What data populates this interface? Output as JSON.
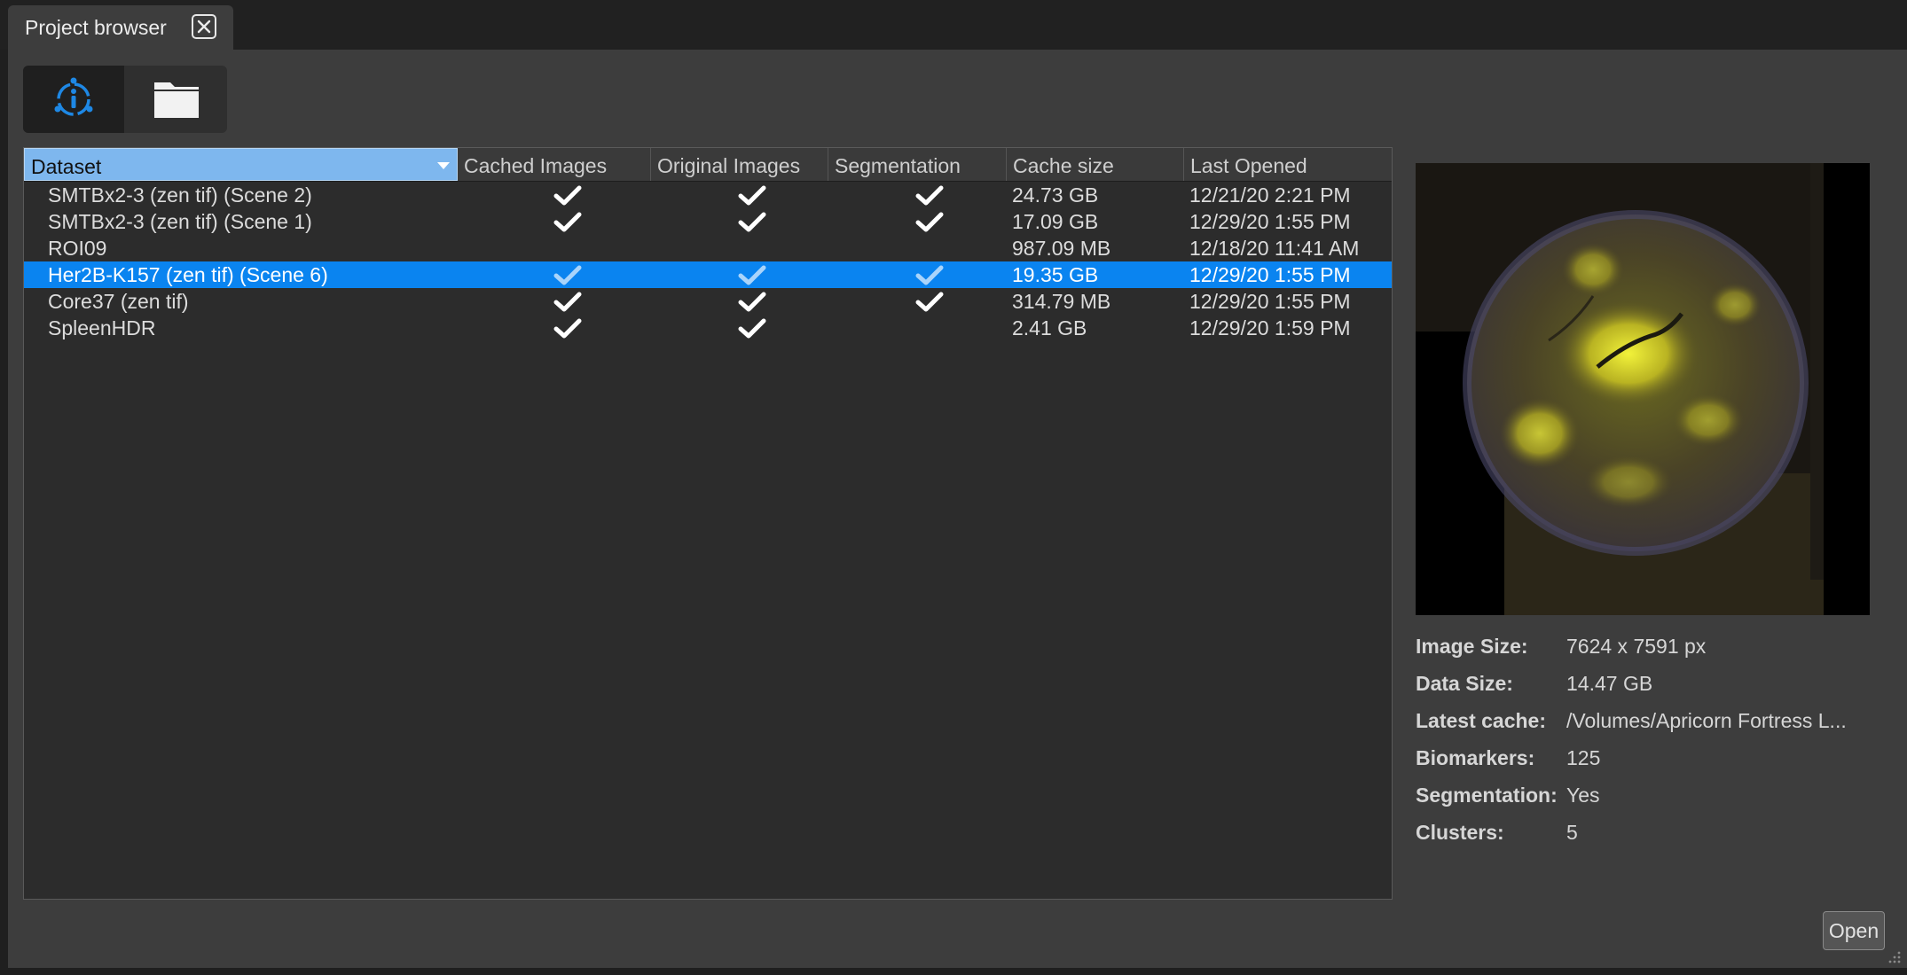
{
  "window": {
    "tab_title": "Project browser"
  },
  "toolbar": {
    "modes": [
      "info-icon",
      "folder-icon"
    ],
    "active": "info"
  },
  "table": {
    "columns": [
      "Dataset",
      "Cached Images",
      "Original Images",
      "Segmentation",
      "Cache size",
      "Last Opened"
    ],
    "sorted_column": "Dataset",
    "rows": [
      {
        "dataset": "SMTBx2-3 (zen tif) (Scene 2)",
        "cached": true,
        "original": true,
        "segmentation": true,
        "cache_size": "24.73 GB",
        "last_opened": "12/21/20 2:21 PM"
      },
      {
        "dataset": "SMTBx2-3 (zen tif) (Scene 1)",
        "cached": true,
        "original": true,
        "segmentation": true,
        "cache_size": "17.09 GB",
        "last_opened": "12/29/20 1:55 PM"
      },
      {
        "dataset": "ROI09",
        "cached": false,
        "original": false,
        "segmentation": false,
        "cache_size": "987.09 MB",
        "last_opened": "12/18/20 11:41 AM"
      },
      {
        "dataset": "Her2B-K157 (zen tif) (Scene 6)",
        "cached": true,
        "original": true,
        "segmentation": true,
        "cache_size": "19.35 GB",
        "last_opened": "12/29/20 1:55 PM",
        "selected": true
      },
      {
        "dataset": "Core37 (zen tif)",
        "cached": true,
        "original": true,
        "segmentation": true,
        "cache_size": "314.79 MB",
        "last_opened": "12/29/20 1:55 PM"
      },
      {
        "dataset": "SpleenHDR",
        "cached": true,
        "original": true,
        "segmentation": false,
        "cache_size": "2.41 GB",
        "last_opened": "12/29/20 1:59 PM"
      }
    ]
  },
  "details": {
    "image_size_label": "Image Size:",
    "image_size": "7624 x 7591 px",
    "data_size_label": "Data Size:",
    "data_size": "14.47 GB",
    "latest_cache_label": "Latest cache:",
    "latest_cache": "/Volumes/Apricorn Fortress L...",
    "biomarkers_label": "Biomarkers:",
    "biomarkers": "125",
    "segmentation_label": "Segmentation:",
    "segmentation": "Yes",
    "clusters_label": "Clusters:",
    "clusters": "5"
  },
  "actions": {
    "open_label": "Open"
  },
  "colors": {
    "selection": "#0a84f0",
    "sorted_header": "#7eb7ee",
    "icon_blue": "#1e88e5"
  }
}
